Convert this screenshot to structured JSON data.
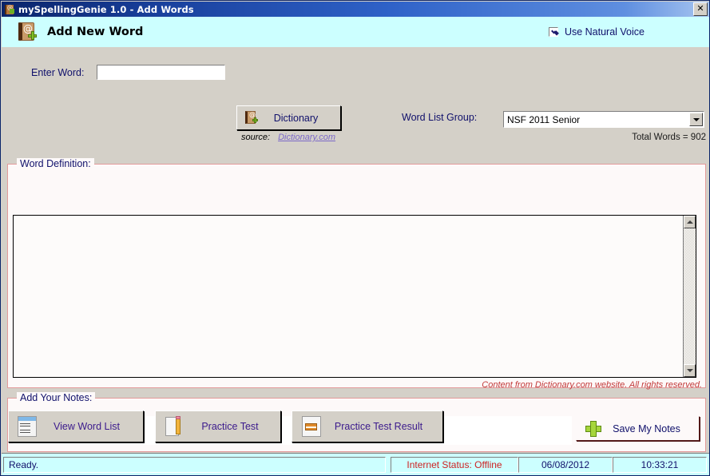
{
  "window": {
    "title": "mySpellingGenie 1.0 - Add Words",
    "icon": "book-at-plus-icon",
    "close_label": "✕"
  },
  "header": {
    "icon": "add-word-book-icon",
    "title": "Add New Word",
    "natural_voice": {
      "label": "Use Natural Voice",
      "checked": true
    }
  },
  "form": {
    "enter_word_label": "Enter Word:",
    "enter_word_value": "",
    "enter_word_placeholder": "",
    "dictionary_button": "Dictionary",
    "source_label": "source:",
    "source_link": "Dictionary.com",
    "word_list_group_label": "Word List Group:",
    "word_list_group_value": "NSF 2011 Senior",
    "word_list_group_options": [
      "NSF 2011 Senior"
    ],
    "total_words": "Total Words = 902"
  },
  "definition": {
    "legend": "Word Definition:",
    "text": "",
    "footnote": "Content from Dictionary.com website. All rights reserved."
  },
  "notes": {
    "legend": "Add Your Notes:",
    "value": "",
    "placeholder": "",
    "save_button": "Save My Notes"
  },
  "toolbar": {
    "view_word_list": "View Word List",
    "practice_test": "Practice Test",
    "practice_test_result": "Practice Test Result"
  },
  "statusbar": {
    "ready": "Ready.",
    "internet_status": "Internet Status: Offline",
    "date": "06/08/2012",
    "time": "10:33:21"
  },
  "colors": {
    "title_bar": "#0a246a",
    "header_band": "#ccffff",
    "group_border": "#e39a9a",
    "label_text": "#10106b",
    "offline_red": "#cc2222",
    "footnote_red": "#c23a3a",
    "tool_label": "#3b1a8c"
  }
}
